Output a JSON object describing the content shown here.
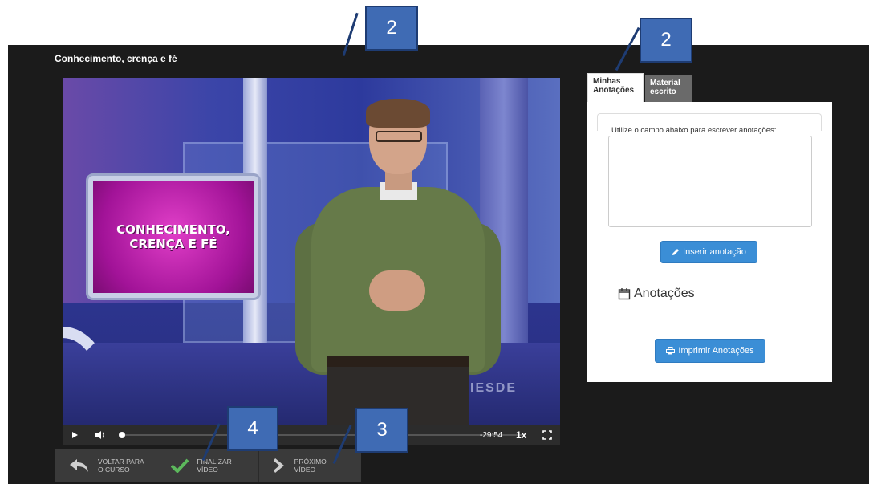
{
  "video": {
    "title": "Conhecimento, crença e fé",
    "screen_text": "CONHECIMENTO,\nCRENÇA E FÉ",
    "watermark": "IESDE",
    "controls": {
      "play_icon": "play-icon",
      "volume_icon": "volume-icon",
      "time_remaining": "-29:54",
      "speed": "1x",
      "fullscreen_icon": "fullscreen-icon"
    }
  },
  "bottom_nav": [
    {
      "label": "VOLTAR PARA\nO CURSO",
      "icon": "back-arrow-icon"
    },
    {
      "label": "FINALIZAR\nVÍDEO",
      "icon": "checkmark-icon"
    },
    {
      "label": "PRÓXIMO\nVÍDEO",
      "icon": "chevron-right-icon"
    }
  ],
  "notes_panel": {
    "tabs": [
      {
        "label": "Minhas\nAnotações",
        "active": true
      },
      {
        "label": "Material\nescrito",
        "active": false
      }
    ],
    "hint": "Utilize o campo abaixo para escrever anotações:",
    "textarea_value": "",
    "insert_button": "Inserir anotação",
    "notes_heading": "Anotações",
    "print_button": "Imprimir Anotações"
  },
  "callouts": [
    "2",
    "2",
    "4",
    "3"
  ],
  "colors": {
    "accent_blue": "#3b8ed6",
    "callout_blue": "#3f6bb4",
    "dark_bg": "#1b1b1b",
    "check_green": "#5cb85c"
  }
}
